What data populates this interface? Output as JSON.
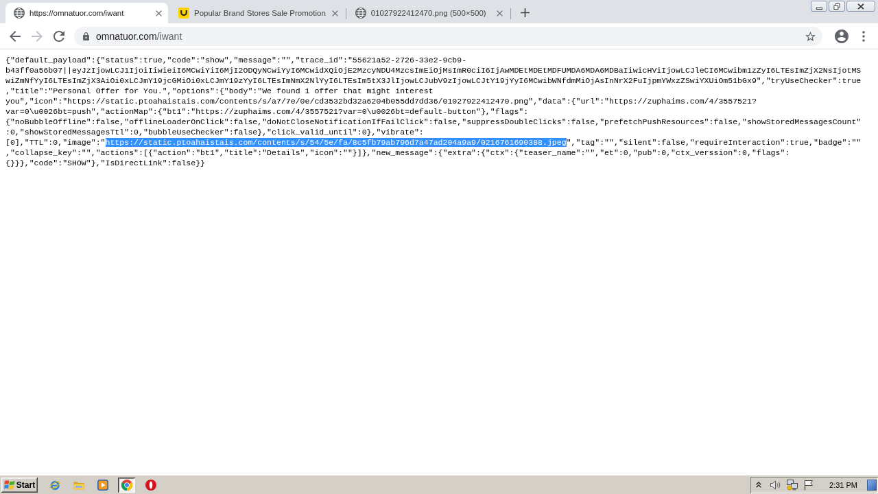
{
  "browser": {
    "tabs": [
      {
        "kind": "default",
        "title": "https://omnatuor.com/iwant",
        "selected": true
      },
      {
        "kind": "site",
        "title": "Popular Brand Stores Sale Promotion",
        "selected": false
      },
      {
        "kind": "default",
        "title": "01027922412470.png (500×500)",
        "selected": false
      }
    ],
    "nav_buttons": [
      {
        "kind": "back",
        "disabled": false
      },
      {
        "kind": "forward",
        "disabled": true
      },
      {
        "kind": "reload",
        "disabled": false
      }
    ],
    "address": {
      "host": "omnatuor.com",
      "path": "/iwant",
      "bookmarked": false
    }
  },
  "page": {
    "lines": [
      {
        "segments": [
          {
            "text": "{\"default_payload\":{\"status\":true,\"code\":\"show\",\"message\":\"\",\"trace_id\":\"55621a52-2726-33e2-9cb9-",
            "selected": false
          }
        ]
      },
      {
        "segments": [
          {
            "text": "b43ff0a56b07||eyJzIjowLCJ1IjoiIiwieiI6MCwiYiI6MjI2ODQyNCwiYyI6MCwidXQiOjE2MzcyNDU4MzcsImEiOjMsImR0ciI6IjAwMDEtMDEtMDFUMDA6MDA6MDBaIiwicHViIjowLCJleCI6MCwibm1zZyI6LTEsImZjX2NsIjotMS",
            "selected": false
          }
        ]
      },
      {
        "segments": [
          {
            "text": "wiZmNfYyI6LTEsImZjX3AiOi0xLCJmY19jcGMiOi0xLCJmY19zYyI6LTEsImNmX2NlYyI6LTEsIm5tX3JlIjowLCJubV9zIjowLCJtY19jYyI6MCwibWNfdmMiOjAsInNrX2FuIjpmYWxzZSwiYXUiOm51bGx9\",\"tryUseChecker\":true",
            "selected": false
          }
        ]
      },
      {
        "segments": [
          {
            "text": ",\"title\":\"Personal Offer for You.\",\"options\":{\"body\":\"We found 1 offer that might interest",
            "selected": false
          }
        ]
      },
      {
        "segments": [
          {
            "text": "you\",\"icon\":\"https://static.ptoahaistais.com/contents/s/a7/7e/0e/cd3532bd32a6204b055dd7dd36/01027922412470.png\",\"data\":{\"url\":\"https://zuphaims.com/4/3557521?",
            "selected": false
          }
        ]
      },
      {
        "segments": [
          {
            "text": "var=0\\u0026bt=push\",\"actionMap\":{\"bt1\":\"https://zuphaims.com/4/3557521?var=0\\u0026bt=default-button\"},\"flags\":",
            "selected": false
          }
        ]
      },
      {
        "segments": [
          {
            "text": "{\"noBubbleOffline\":false,\"offlineLoaderOnClick\":false,\"doNotCloseNotificationIfFailClick\":false,\"suppressDoubleClicks\":false,\"prefetchPushResources\":false,\"showStoredMessagesCount\"",
            "selected": false
          }
        ]
      },
      {
        "segments": [
          {
            "text": ":0,\"showStoredMessagesTtl\":0,\"bubbleUseChecker\":false},\"click_valid_until\":0},\"vibrate\":",
            "selected": false
          }
        ]
      },
      {
        "segments": [
          {
            "text": "[0],\"TTL\":0,\"image\":\"",
            "selected": false
          },
          {
            "text": "https://static.ptoahaistais.com/contents/s/54/5e/fa/8c5fb79ab796d7a47ad204a9a9/0216761690388.jpeg",
            "selected": true
          },
          {
            "text": "\",\"tag\":\"\",\"silent\":false,\"requireInteraction\":true,\"badge\":\"\"",
            "selected": false
          }
        ]
      },
      {
        "segments": [
          {
            "text": ",\"collapse_key\":\"\",\"actions\":[{\"action\":\"bt1\",\"title\":\"Details\",\"icon\":\"\"}]},\"new_message\":{\"extra\":{\"ctx\":{\"teaser_name\":\"\",\"et\":0,\"pub\":0,\"ctx_verssion\":0,\"flags\":",
            "selected": false
          }
        ]
      },
      {
        "segments": [
          {
            "text": "{}}},\"code\":\"SHOW\"},\"IsDirectLink\":false}}",
            "selected": false
          }
        ]
      }
    ]
  },
  "taskbar": {
    "start": "Start",
    "apps": [
      {
        "kind": "web",
        "selected": false
      },
      {
        "kind": "folder",
        "selected": false
      },
      {
        "kind": "player",
        "selected": false
      },
      {
        "kind": "browser",
        "selected": true
      },
      {
        "kind": "ring",
        "selected": false
      }
    ],
    "clock": "2:31 PM"
  }
}
